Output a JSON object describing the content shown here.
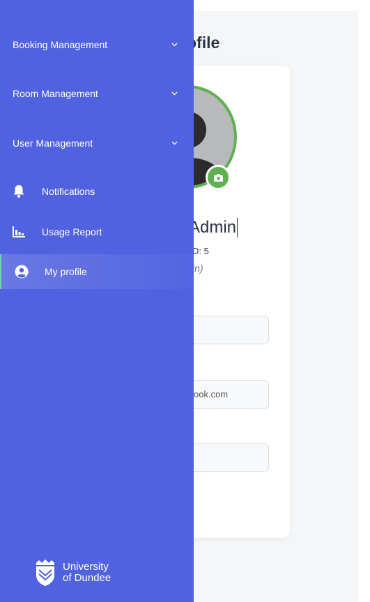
{
  "page": {
    "title": "ofile",
    "profile_name": "Admin",
    "profile_id": "D: 5",
    "profile_role": "in)",
    "fields": [
      {
        "value": ""
      },
      {
        "value": "ook.com"
      },
      {
        "value": ""
      }
    ]
  },
  "sidebar": {
    "groups": [
      {
        "label": "Booking Management"
      },
      {
        "label": "Room Management"
      },
      {
        "label": "User Management"
      }
    ],
    "items": [
      {
        "label": "Notifications",
        "icon": "bell-icon"
      },
      {
        "label": "Usage Report",
        "icon": "chart-icon"
      },
      {
        "label": "My profile",
        "icon": "user-circle-icon",
        "active": true
      }
    ],
    "logo": {
      "line1": "University",
      "line2": "of Dundee"
    }
  },
  "colors": {
    "sidebar": "#5062e0",
    "accent_green": "#5fb04f",
    "active_border": "#6fd3b0"
  }
}
